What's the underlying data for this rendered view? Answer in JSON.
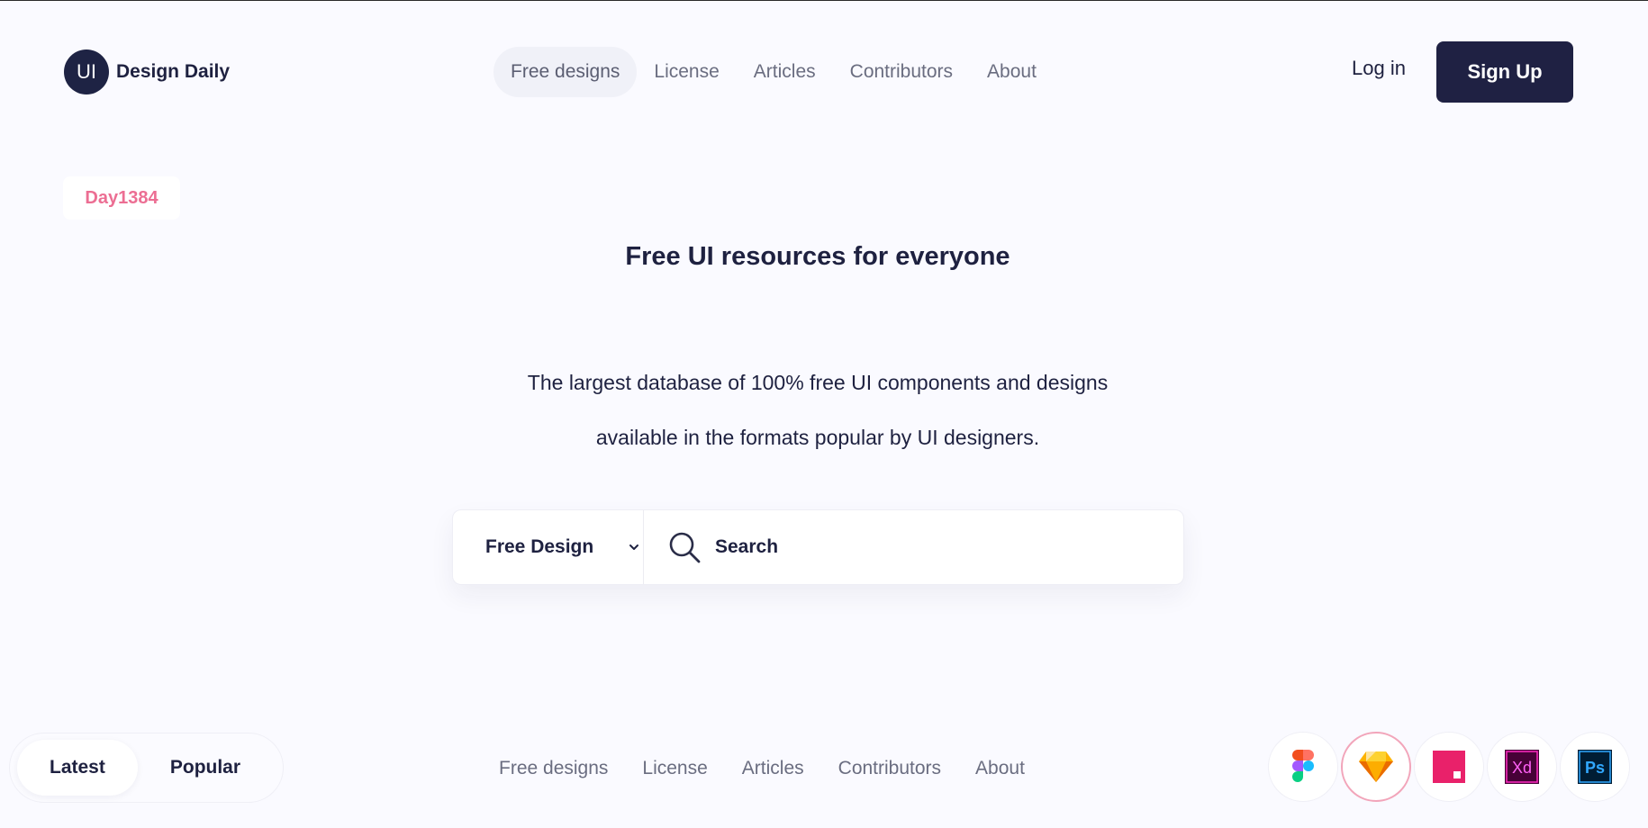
{
  "brand": {
    "logo_mark": "UI",
    "name": "Design Daily"
  },
  "nav": {
    "items": [
      {
        "label": "Free designs",
        "active": true
      },
      {
        "label": "License",
        "active": false
      },
      {
        "label": "Articles",
        "active": false
      },
      {
        "label": "Contributors",
        "active": false
      },
      {
        "label": "About",
        "active": false
      }
    ]
  },
  "auth": {
    "login_label": "Log in",
    "signup_label": "Sign Up"
  },
  "badge": {
    "day": "Day1384"
  },
  "hero": {
    "title": "Free UI resources for everyone",
    "subtitle_line1": "The largest database of 100% free UI components and designs",
    "subtitle_line2": "available in the formats popular by UI designers."
  },
  "search": {
    "category_selected": "Free Design",
    "placeholder": "Search"
  },
  "sort": {
    "options": [
      {
        "label": "Latest",
        "active": true
      },
      {
        "label": "Popular",
        "active": false
      }
    ]
  },
  "footer_nav": {
    "items": [
      "Free designs",
      "License",
      "Articles",
      "Contributors",
      "About"
    ]
  },
  "tools": {
    "items": [
      {
        "icon": "figma-icon",
        "active": false
      },
      {
        "icon": "sketch-icon",
        "active": true
      },
      {
        "icon": "invision-studio-icon",
        "active": false
      },
      {
        "icon": "adobe-xd-icon",
        "label": "Xd",
        "active": false
      },
      {
        "icon": "photoshop-icon",
        "label": "Ps",
        "active": false
      }
    ]
  },
  "colors": {
    "primary": "#1f2143",
    "accent_pink": "#ec6e93",
    "background": "#fafaff"
  }
}
